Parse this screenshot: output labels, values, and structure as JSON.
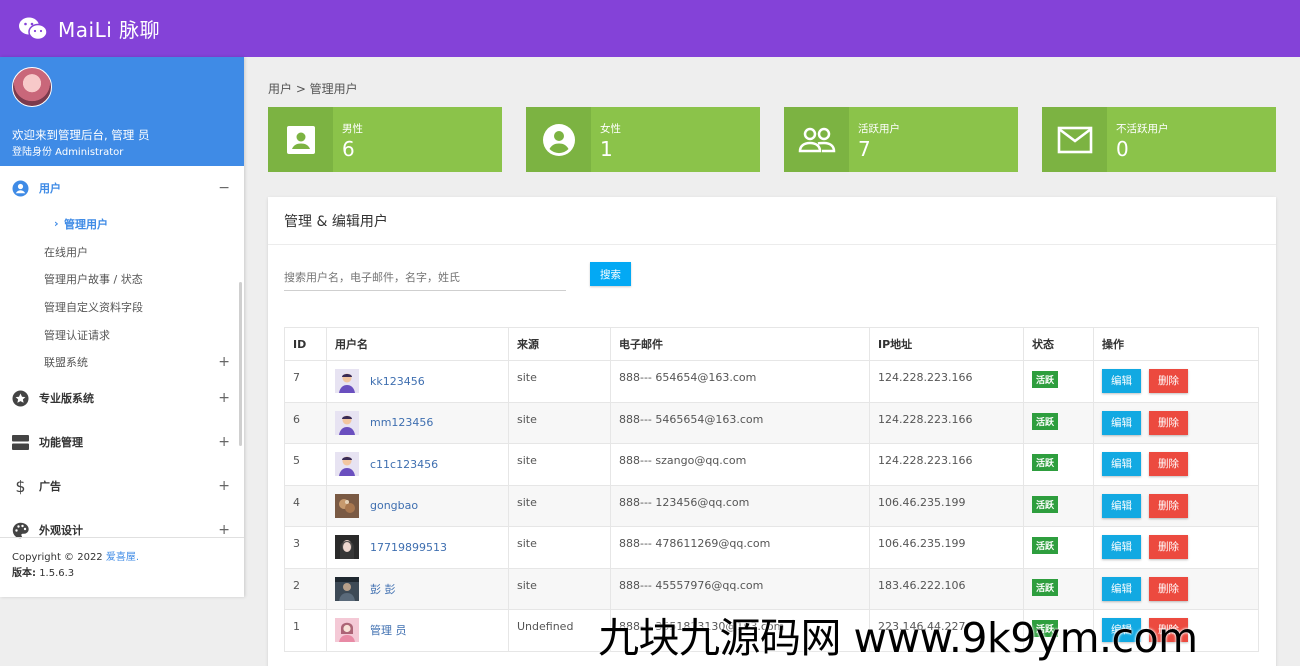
{
  "app": {
    "brand": "MaiLi 脉聊"
  },
  "profile": {
    "welcome": "欢迎来到管理后台, 管理 员",
    "role": "登陆身份 Administrator"
  },
  "sidebar": {
    "sections": [
      {
        "label": "用户",
        "icon": "user-circle-icon",
        "toggle": "−",
        "active": true
      },
      {
        "label": "专业版系统",
        "icon": "star-circle-icon",
        "toggle": "+"
      },
      {
        "label": "功能管理",
        "icon": "server-icon",
        "toggle": "+"
      },
      {
        "label": "广告",
        "icon": "dollar-icon",
        "toggle": "+"
      },
      {
        "label": "外观设计",
        "icon": "palette-icon",
        "toggle": "+"
      }
    ],
    "user_items": [
      {
        "label": "管理用户",
        "current": true
      },
      {
        "label": "在线用户"
      },
      {
        "label": "管理用户故事 / 状态"
      },
      {
        "label": "管理自定义资料字段"
      },
      {
        "label": "管理认证请求"
      },
      {
        "label": "联盟系统",
        "toggle": "+"
      }
    ],
    "footer": {
      "copyright": "Copyright © 2022",
      "link": "爱喜屋.",
      "version_label": "版本:",
      "version": "1.5.6.3"
    }
  },
  "breadcrumb": "用户 > 管理用户",
  "stats": [
    {
      "label": "男性",
      "value": "6",
      "icon": "contact-card-icon"
    },
    {
      "label": "女性",
      "value": "1",
      "icon": "account-circle-icon"
    },
    {
      "label": "活跃用户",
      "value": "7",
      "icon": "people-icon"
    },
    {
      "label": "不活跃用户",
      "value": "0",
      "icon": "mail-icon"
    }
  ],
  "card": {
    "title": "管理 & 编辑用户"
  },
  "search": {
    "placeholder": "搜索用户名，电子邮件，名字，姓氏",
    "button": "搜索"
  },
  "table": {
    "headers": [
      "ID",
      "用户名",
      "来源",
      "电子邮件",
      "IP地址",
      "状态",
      "操作"
    ],
    "rows": [
      {
        "id": "7",
        "username": "kk123456",
        "source": "site",
        "email": "888---  654654@163.com",
        "ip": "124.228.223.166",
        "status": "活跃",
        "avatar": "default"
      },
      {
        "id": "6",
        "username": "mm123456",
        "source": "site",
        "email": "888---  5465654@163.com",
        "ip": "124.228.223.166",
        "status": "活跃",
        "avatar": "default"
      },
      {
        "id": "5",
        "username": "c11c123456",
        "source": "site",
        "email": "888---  szango@qq.com",
        "ip": "124.228.223.166",
        "status": "活跃",
        "avatar": "default"
      },
      {
        "id": "4",
        "username": "gongbao",
        "source": "site",
        "email": "888---  123456@qq.com",
        "ip": "106.46.235.199",
        "status": "活跃",
        "avatar": "food"
      },
      {
        "id": "3",
        "username": "17719899513",
        "source": "site",
        "email": "888---  478611269@qq.com",
        "ip": "106.46.235.199",
        "status": "活跃",
        "avatar": "girl"
      },
      {
        "id": "2",
        "username": "彭 彭",
        "source": "site",
        "email": "888---  45557976@qq.com",
        "ip": "183.46.222.106",
        "status": "活跃",
        "avatar": "photo"
      },
      {
        "id": "1",
        "username": "管理 员",
        "source": "Undefined",
        "email": "888---  3551813130@163.com",
        "ip": "223.146.44.227",
        "status": "活跃",
        "avatar": "pink"
      }
    ],
    "actions": {
      "edit": "编辑",
      "delete": "删除"
    }
  },
  "watermark": "九块九源码网 www.9k9ym.com",
  "colors": {
    "topbar": "#8442d8",
    "profile": "#3f8be6",
    "stat": "#8bc34a",
    "active": "#2e9e3e",
    "edit": "#12a9e2",
    "delete": "#ec4a3f"
  }
}
